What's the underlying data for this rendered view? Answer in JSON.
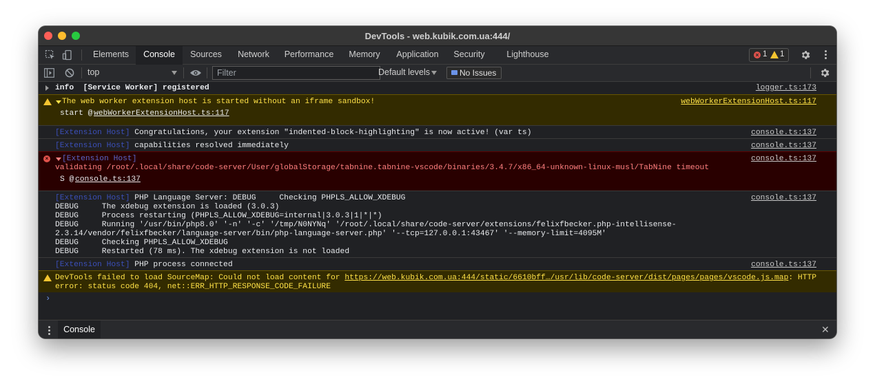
{
  "window": {
    "title": "DevTools - web.kubik.com.ua:444/"
  },
  "tabs": [
    {
      "label": "Elements"
    },
    {
      "label": "Console"
    },
    {
      "label": "Sources"
    },
    {
      "label": "Network"
    },
    {
      "label": "Performance"
    },
    {
      "label": "Memory"
    },
    {
      "label": "Application"
    },
    {
      "label": "Security"
    },
    {
      "label": "Lighthouse"
    }
  ],
  "active_tab": "Console",
  "status": {
    "errors": "1",
    "warnings": "1"
  },
  "toolbar": {
    "context": "top",
    "filter_placeholder": "Filter",
    "levels": "Default levels",
    "issues": "No Issues"
  },
  "messages": [
    {
      "level": "info",
      "text": "info  [Service Worker] registered",
      "source": "logger.ts:173"
    },
    {
      "level": "warning",
      "text": "The web worker extension host is started without an iframe sandbox!",
      "stack_prefix": "start @ ",
      "stack_link": "webWorkerExtensionHost.ts:117",
      "source": "webWorkerExtensionHost.ts:117"
    },
    {
      "level": "log",
      "tag": "[Extension Host]",
      "text": " Congratulations, your extension \"indented-block-highlighting\" is now active! (var ts)",
      "source": "console.ts:137"
    },
    {
      "level": "log",
      "tag": "[Extension Host]",
      "text": " capabilities resolved immediately",
      "source": "console.ts:137"
    },
    {
      "level": "error",
      "tag": "[Extension Host]",
      "text": "validating /root/.local/share/code-server/User/globalStorage/tabnine.tabnine-vscode/binaries/3.4.7/x86_64-unknown-linux-musl/TabNine timeout",
      "stack_prefix": "S @ ",
      "stack_link": "console.ts:137",
      "source": "console.ts:137"
    },
    {
      "level": "log",
      "tag": "[Extension Host]",
      "text": " PHP Language Server: DEBUG     Checking PHPLS_ALLOW_XDEBUG",
      "lines": [
        "DEBUG     The xdebug extension is loaded (3.0.3)",
        "DEBUG     Process restarting (PHPLS_ALLOW_XDEBUG=internal|3.0.3|1|*|*)",
        "DEBUG     Running '/usr/bin/php8.0' '-n' '-c' '/tmp/N0NYNq' '/root/.local/share/code-server/extensions/felixfbecker.php-intellisense-",
        "2.3.14/vendor/felixfbecker/language-server/bin/php-language-server.php' '--tcp=127.0.0.1:43467' '--memory-limit=4095M'",
        "DEBUG     Checking PHPLS_ALLOW_XDEBUG",
        "DEBUG     Restarted (78 ms). The xdebug extension is not loaded"
      ],
      "source": "console.ts:137"
    },
    {
      "level": "log",
      "tag": "[Extension Host]",
      "text": " PHP process connected",
      "source": "console.ts:137"
    },
    {
      "level": "warning",
      "prefix": "DevTools failed to load SourceMap: Could not load content for ",
      "link": "https://web.kubik.com.ua:444/static/6610bff…/usr/lib/code-server/dist/pages/pages/vscode.js.map",
      "suffix": ": HTTP",
      "line2": "error: status code 404, net::ERR_HTTP_RESPONSE_CODE_FAILURE"
    }
  ],
  "prompt": "›",
  "drawer": {
    "tab": "Console",
    "close": "✕"
  },
  "colors": {
    "accent": "#6b93e8",
    "warning_bg": "#332b00",
    "error_bg": "#290000",
    "extension_tag": "#3b4fb8"
  }
}
